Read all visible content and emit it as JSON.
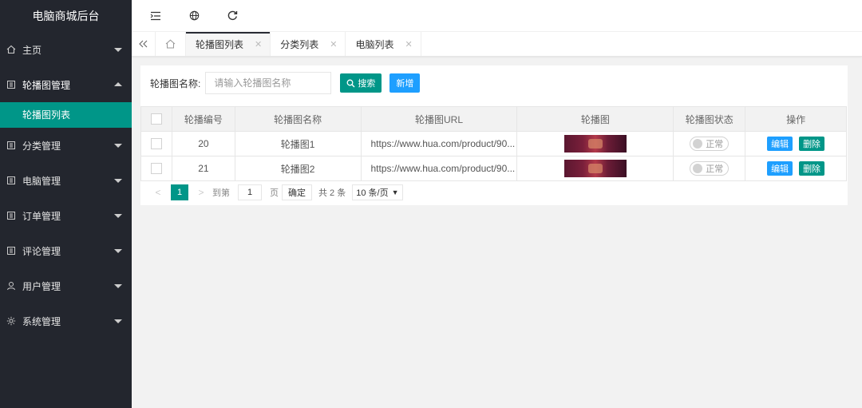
{
  "app": {
    "title": "电脑商城后台"
  },
  "sidebar": {
    "items": [
      {
        "label": "主页",
        "icon": "home-icon",
        "expanded": false
      },
      {
        "label": "轮播图管理",
        "icon": "list-icon",
        "expanded": true,
        "children": [
          {
            "label": "轮播图列表",
            "active": true
          }
        ]
      },
      {
        "label": "分类管理",
        "icon": "list-icon",
        "expanded": false
      },
      {
        "label": "电脑管理",
        "icon": "list-icon",
        "expanded": false
      },
      {
        "label": "订单管理",
        "icon": "list-icon",
        "expanded": false
      },
      {
        "label": "评论管理",
        "icon": "list-icon",
        "expanded": false
      },
      {
        "label": "用户管理",
        "icon": "user-icon",
        "expanded": false
      },
      {
        "label": "系统管理",
        "icon": "gear-icon",
        "expanded": false
      }
    ]
  },
  "topbar": {
    "tools": [
      "menu-toggle-icon",
      "globe-icon",
      "refresh-icon"
    ]
  },
  "tabs": [
    {
      "label": "轮播图列表",
      "active": true
    },
    {
      "label": "分类列表",
      "active": false
    },
    {
      "label": "电脑列表",
      "active": false
    }
  ],
  "search": {
    "label": "轮播图名称:",
    "placeholder": "请输入轮播图名称",
    "value": "",
    "search_button": "搜索",
    "add_button": "新增"
  },
  "table": {
    "columns": [
      "",
      "轮播编号",
      "轮播图名称",
      "轮播图URL",
      "轮播图",
      "轮播图状态",
      "操作"
    ],
    "rows": [
      {
        "id": "20",
        "name": "轮播图1",
        "url": "https://www.hua.com/product/90...",
        "status": "正常",
        "edit": "编辑",
        "delete": "删除"
      },
      {
        "id": "21",
        "name": "轮播图2",
        "url": "https://www.hua.com/product/90...",
        "status": "正常",
        "edit": "编辑",
        "delete": "删除"
      }
    ]
  },
  "pager": {
    "current": "1",
    "goto_label": "到第",
    "goto_value": "1",
    "page_unit": "页",
    "confirm": "确定",
    "total": "共 2 条",
    "page_size": "10 条/页"
  },
  "colors": {
    "sidebar_bg": "#23262e",
    "accent": "#009688",
    "blue": "#1e9fff"
  }
}
